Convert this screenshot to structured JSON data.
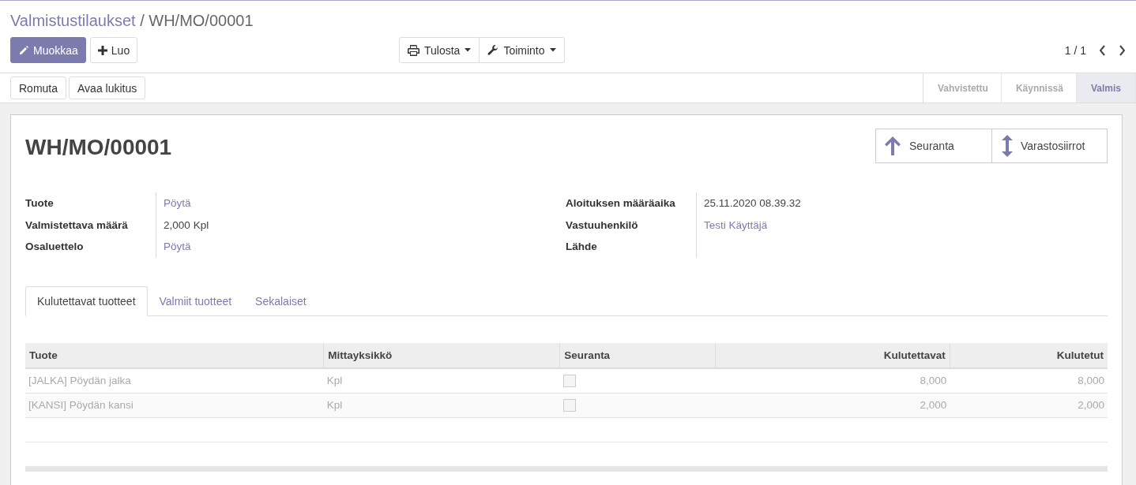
{
  "breadcrumb": {
    "parent": "Valmistustilaukset",
    "separator": "/",
    "current": "WH/MO/00001"
  },
  "buttons": [
    {
      "label": "Muokkaa",
      "kind": "primary"
    },
    {
      "label": "Luo",
      "kind": "default"
    }
  ],
  "menus": [
    {
      "label": "Tulosta"
    },
    {
      "label": "Toiminto"
    }
  ],
  "pager": {
    "text": "1 / 1"
  },
  "header_buttons": [
    "Romuta",
    "Avaa lukitus"
  ],
  "states": [
    {
      "label": "Vahvistettu",
      "selected": false
    },
    {
      "label": "Käynnissä",
      "selected": false
    },
    {
      "label": "Valmis",
      "selected": true
    }
  ],
  "smart_buttons": [
    {
      "label": "Seuranta"
    },
    {
      "label": "Varastosiirrot"
    }
  ],
  "title": "WH/MO/00001",
  "fields_left": [
    {
      "label": "Tuote",
      "value": "Pöytä",
      "kind": "link"
    },
    {
      "label": "Valmistettava määrä",
      "value": "2,000",
      "unit": "Kpl",
      "kind": "text"
    },
    {
      "label": "Osaluettelo",
      "value": "Pöytä",
      "kind": "link"
    }
  ],
  "fields_right": [
    {
      "label": "Aloituksen määräaika",
      "value": "25.11.2020 08.39.32",
      "kind": "text"
    },
    {
      "label": "Vastuuhenkilö",
      "value": "Testi Käyttäjä",
      "kind": "link"
    },
    {
      "label": "Lähde",
      "kind": "empty"
    }
  ],
  "tabs": [
    {
      "label": "Kulutettavat tuotteet",
      "selected": true
    },
    {
      "label": "Valmiit tuotteet",
      "selected": false
    },
    {
      "label": "Sekalaiset",
      "selected": false
    }
  ],
  "table": {
    "columns": [
      {
        "label": "Tuote",
        "kind": "text"
      },
      {
        "label": "Mittayksikkö",
        "kind": "text"
      },
      {
        "label": "Seuranta",
        "kind": "check"
      },
      {
        "label": "Kulutettavat",
        "kind": "number"
      },
      {
        "label": "Kulutetut",
        "kind": "number"
      }
    ],
    "rows": [
      {
        "cells": [
          "[JALKA] Pöydän jalka",
          "Kpl",
          false,
          "8,000",
          "8,000"
        ]
      },
      {
        "cells": [
          "[KANSI] Pöydän kansi",
          "Kpl",
          false,
          "2,000",
          "2,000"
        ]
      }
    ]
  }
}
